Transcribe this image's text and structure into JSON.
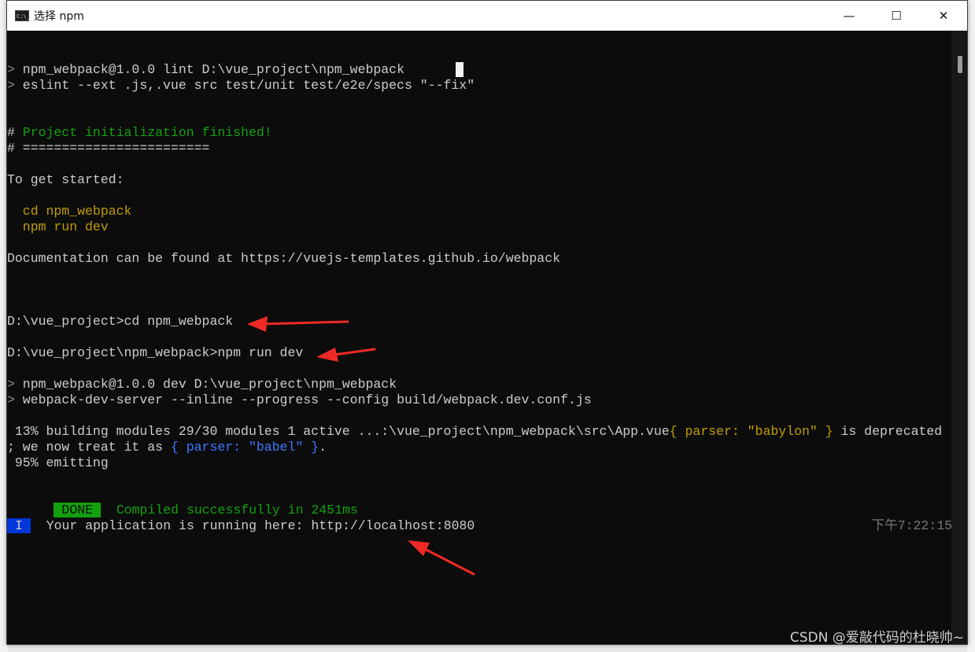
{
  "window": {
    "title": "选择 npm",
    "icon": "terminal-app-icon",
    "minimize_glyph": "—",
    "maximize_glyph": "☐",
    "close_glyph": "✕"
  },
  "console": {
    "prompt_marker": ">",
    "line1": " npm_webpack@1.0.0 lint D:\\vue_project\\npm_webpack",
    "line2": " eslint --ext .js,.vue src test/unit test/e2e/specs \"--fix\"",
    "hash": "#",
    "project_finished": " Project initialization finished!",
    "separator": " ========================",
    "to_get_started": "To get started:",
    "cmd_cd": "  cd npm_webpack",
    "cmd_run": "  npm run dev",
    "docs": "Documentation can be found at https://vuejs-templates.github.io/webpack",
    "prompt1": "D:\\vue_project>cd npm_webpack",
    "prompt2": "D:\\vue_project\\npm_webpack>npm run dev",
    "line3": " npm_webpack@1.0.0 dev D:\\vue_project\\npm_webpack",
    "line4": " webpack-dev-server --inline --progress --config build/webpack.dev.conf.js",
    "building_a": " 13% building modules 29/30 modules 1 active ...:\\vue_project\\npm_webpack\\src\\App.vue",
    "building_b": "{ parser: \"babylon\" }",
    "building_c": " is deprecated",
    "treat_a": "; we now treat it as ",
    "treat_b": "{ parser: \"babel\" }",
    "treat_c": ".",
    "emitting": " 95% emitting",
    "done_badge": "DONE",
    "compiled": "  Compiled successfully in 2451ms",
    "time": "下午7:22:15",
    "info_badge": "I",
    "running": "  Your application is running here: http://localhost:8080"
  },
  "annotation_color": "#ee2a24",
  "watermark": "CSDN @爱敲代码的杜晓帅~"
}
